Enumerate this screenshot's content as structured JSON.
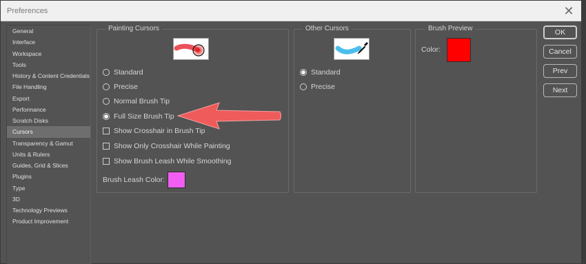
{
  "window": {
    "title": "Preferences",
    "close_symbol": "✕"
  },
  "sidebar": {
    "items": [
      {
        "label": "General"
      },
      {
        "label": "Interface"
      },
      {
        "label": "Workspace"
      },
      {
        "label": "Tools"
      },
      {
        "label": "History & Content Credentials"
      },
      {
        "label": "File Handling"
      },
      {
        "label": "Export"
      },
      {
        "label": "Performance"
      },
      {
        "label": "Scratch Disks"
      },
      {
        "label": "Cursors",
        "selected": true
      },
      {
        "label": "Transparency & Gamut"
      },
      {
        "label": "Units & Rulers"
      },
      {
        "label": "Guides, Grid & Slices"
      },
      {
        "label": "Plugins"
      },
      {
        "label": "Type"
      },
      {
        "label": "3D"
      },
      {
        "label": "Technology Previews"
      },
      {
        "label": "Product Improvement"
      }
    ]
  },
  "painting_cursors": {
    "title": "Painting Cursors",
    "options": [
      {
        "label": "Standard",
        "checked": false
      },
      {
        "label": "Precise",
        "checked": false
      },
      {
        "label": "Normal Brush Tip",
        "checked": false
      },
      {
        "label": "Full Size Brush Tip",
        "checked": true
      }
    ],
    "checkboxes": [
      {
        "label": "Show Crosshair in Brush Tip",
        "checked": false
      },
      {
        "label": "Show Only Crosshair While Painting",
        "checked": false
      },
      {
        "label": "Show Brush Leash While Smoothing",
        "checked": false
      }
    ],
    "leash_color_label": "Brush Leash Color:",
    "leash_color": "#f25ef2"
  },
  "other_cursors": {
    "title": "Other Cursors",
    "options": [
      {
        "label": "Standard",
        "checked": true
      },
      {
        "label": "Precise",
        "checked": false
      }
    ]
  },
  "brush_preview": {
    "title": "Brush Preview",
    "color_label": "Color:",
    "color": "#ff0000"
  },
  "buttons": {
    "ok": "OK",
    "cancel": "Cancel",
    "prev": "Prev",
    "next": "Next"
  },
  "annotation": {
    "arrow_color": "#ef5a5a",
    "points_to": "Full Size Brush Tip"
  }
}
